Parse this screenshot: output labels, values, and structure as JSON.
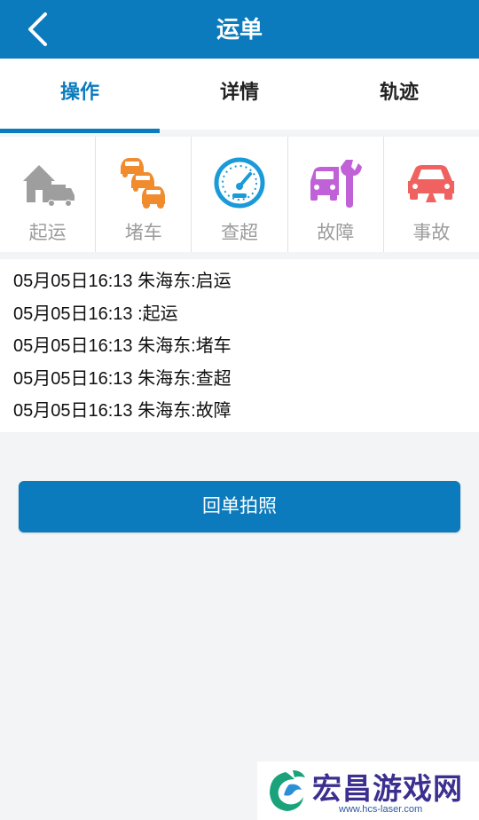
{
  "header": {
    "title": "运单",
    "back_icon": "chevron-left-icon"
  },
  "tabs": [
    {
      "label": "操作",
      "active": true
    },
    {
      "label": "详情",
      "active": false
    },
    {
      "label": "轨迹",
      "active": false
    }
  ],
  "actions": [
    {
      "label": "起运",
      "icon": "truck-depart-icon",
      "color": "#9e9e9e"
    },
    {
      "label": "堵车",
      "icon": "traffic-jam-icon",
      "color": "#f08c2e"
    },
    {
      "label": "查超",
      "icon": "speedometer-icon",
      "color": "#1a9ad8"
    },
    {
      "label": "故障",
      "icon": "car-wrench-icon",
      "color": "#c061d8"
    },
    {
      "label": "事故",
      "icon": "car-crash-icon",
      "color": "#f0625f"
    }
  ],
  "log": [
    "05月05日16:13 朱海东:启运",
    "05月05日16:13 :起运",
    "05月05日16:13 朱海东:堵车",
    "05月05日16:13 朱海东:查超",
    "05月05日16:13 朱海东:故障"
  ],
  "photo_button": {
    "label": "回单拍照"
  },
  "watermark": {
    "name": "宏昌游戏网",
    "url": "www.hcs-laser.com"
  },
  "colors": {
    "accent": "#0b7bbd",
    "background": "#f2f4f5"
  }
}
